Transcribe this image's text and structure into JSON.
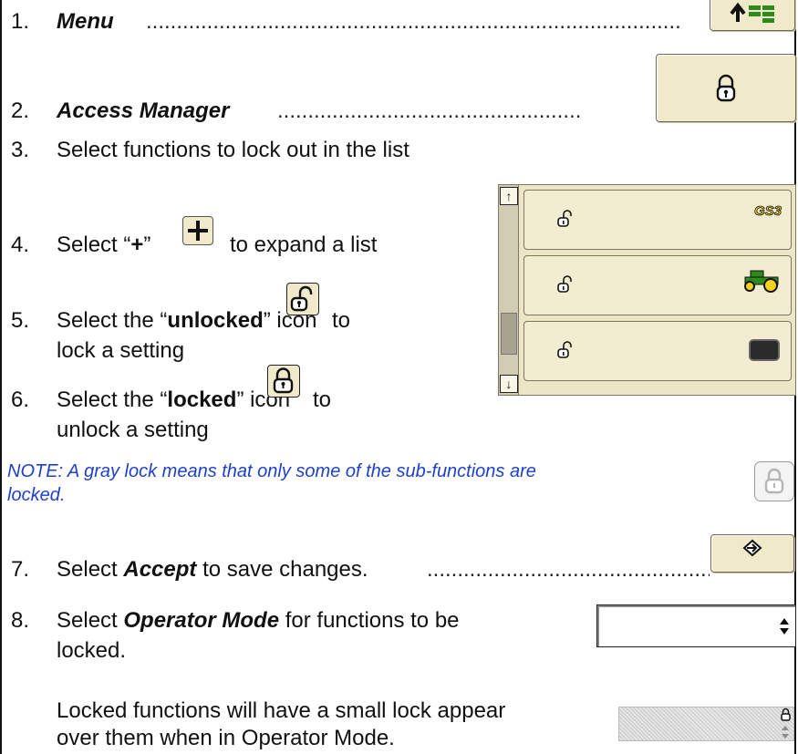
{
  "steps": [
    {
      "num": "1.",
      "label": "Menu",
      "dots": "........................................................................................"
    },
    {
      "num": "2.",
      "label": "Access Manager",
      "dots": ".................................................."
    },
    {
      "num": "3.",
      "text": "Select functions to lock out in the list"
    },
    {
      "num": "4.",
      "pre": "Select “",
      "bold": "+",
      "post": "”",
      "after": "to expand a list"
    },
    {
      "num": "5.",
      "pre": "Select the “",
      "bold": "unlocked",
      "post": "” icon",
      "after": "to",
      "line2": "lock a setting"
    },
    {
      "num": "6.",
      "pre": "Select the “",
      "bold": "locked",
      "post": "” icon",
      "after": "to",
      "line2": "unlock a setting"
    },
    {
      "num": "7.",
      "pre": "Select ",
      "bold": "Accept",
      "post": " to save changes.",
      "dots": "................................................"
    },
    {
      "num": "8.",
      "pre": "Select ",
      "bold": "Operator Mode",
      "post": " for functions to be",
      "line2": "locked."
    }
  ],
  "note": {
    "line1": "NOTE: A gray lock means that only some of the sub-functions are",
    "line2": "locked."
  },
  "locked_info": {
    "line1": "Locked functions will have a small lock appear",
    "line2": "over them when in Operator Mode."
  },
  "panel": {
    "rows": [
      {
        "icon": "gs3-logo",
        "logo_text": "GS3"
      },
      {
        "icon": "tractor-icon"
      },
      {
        "icon": "display-icon"
      }
    ]
  },
  "colors": {
    "button_bg": "#f0eacb",
    "note_text": "#1f3fd0",
    "tractor_green": "#2f8a1e",
    "tractor_yellow": "#f2d21a"
  }
}
